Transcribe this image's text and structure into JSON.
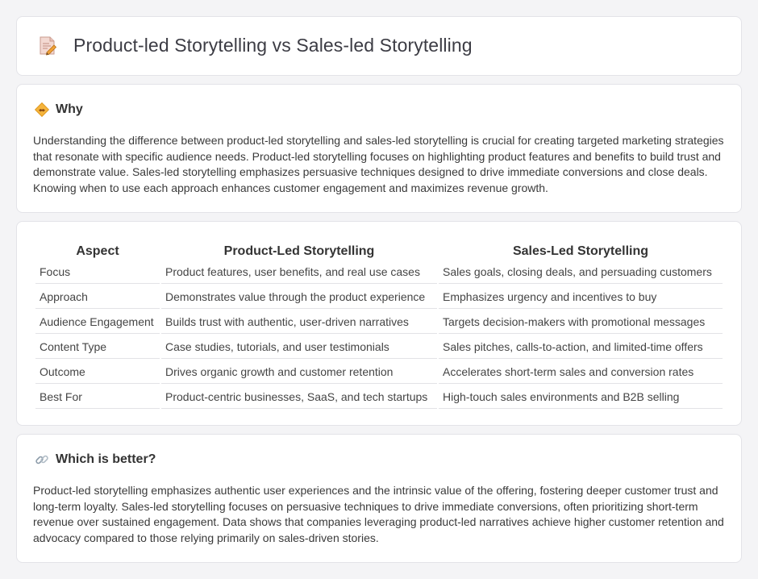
{
  "header": {
    "title": "Product-led Storytelling vs Sales-led Storytelling"
  },
  "why": {
    "title": "Why",
    "body": "Understanding the difference between product-led storytelling and sales-led storytelling is crucial for creating targeted marketing strategies that resonate with specific audience needs. Product-led storytelling focuses on highlighting product features and benefits to build trust and demonstrate value. Sales-led storytelling emphasizes persuasive techniques designed to drive immediate conversions and close deals. Knowing when to use each approach enhances customer engagement and maximizes revenue growth."
  },
  "comparison": {
    "headers": [
      "Aspect",
      "Product-Led Storytelling",
      "Sales-Led Storytelling"
    ],
    "rows": [
      [
        "Focus",
        "Product features, user benefits, and real use cases",
        "Sales goals, closing deals, and persuading customers"
      ],
      [
        "Approach",
        "Demonstrates value through the product experience",
        "Emphasizes urgency and incentives to buy"
      ],
      [
        "Audience Engagement",
        "Builds trust with authentic, user-driven narratives",
        "Targets decision-makers with promotional messages"
      ],
      [
        "Content Type",
        "Case studies, tutorials, and user testimonials",
        "Sales pitches, calls-to-action, and limited-time offers"
      ],
      [
        "Outcome",
        "Drives organic growth and customer retention",
        "Accelerates short-term sales and conversion rates"
      ],
      [
        "Best For",
        "Product-centric businesses, SaaS, and tech startups",
        "High-touch sales environments and B2B selling"
      ]
    ]
  },
  "better": {
    "title": "Which is better?",
    "body": "Product-led storytelling emphasizes authentic user experiences and the intrinsic value of the offering, fostering deeper customer trust and long-term loyalty. Sales-led storytelling focuses on persuasive techniques to drive immediate conversions, often prioritizing short-term revenue over sustained engagement. Data shows that companies leveraging product-led narratives achieve higher customer retention and advocacy compared to those relying primarily on sales-driven stories."
  },
  "icons": {
    "header": "document-pencil-icon",
    "why": "handshake-icon",
    "better": "link-icon"
  }
}
